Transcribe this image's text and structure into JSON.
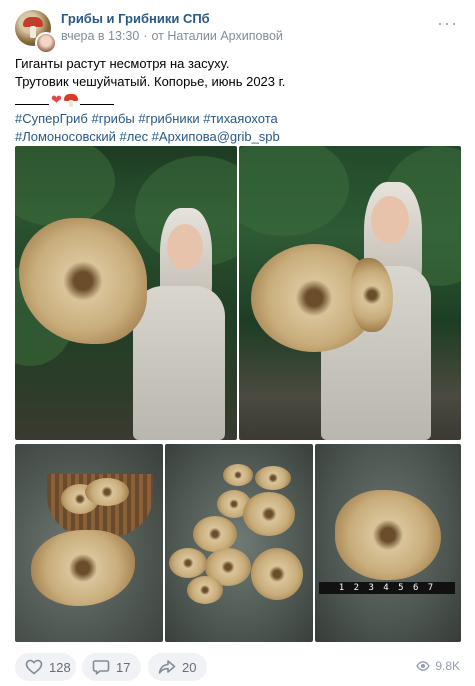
{
  "post": {
    "group_name": "Грибы и Грибники СПб",
    "time": "вчера в 13:30",
    "author": "от Наталии Архиповой",
    "menu_icon": "more-dots-icon"
  },
  "text": {
    "line1": "Гиганты растут несмотря на засуху.",
    "line2": "Трутовик чешуйчатый. Копорье, июнь 2023 г.",
    "hashtags_line1": "#СуперГриб #грибы #грибники #тихаяохота",
    "hashtags_line2": "#Ломоносовский #лес #Архипова@grib_spb"
  },
  "photos": {
    "ruler_text": "1 2 3 4 5 6 7"
  },
  "actions": {
    "likes": "128",
    "comments": "17",
    "shares": "20",
    "views": "9.8K"
  },
  "colors": {
    "link": "#2a5885",
    "muted": "#818c99",
    "pill_bg": "#f0f2f5"
  }
}
